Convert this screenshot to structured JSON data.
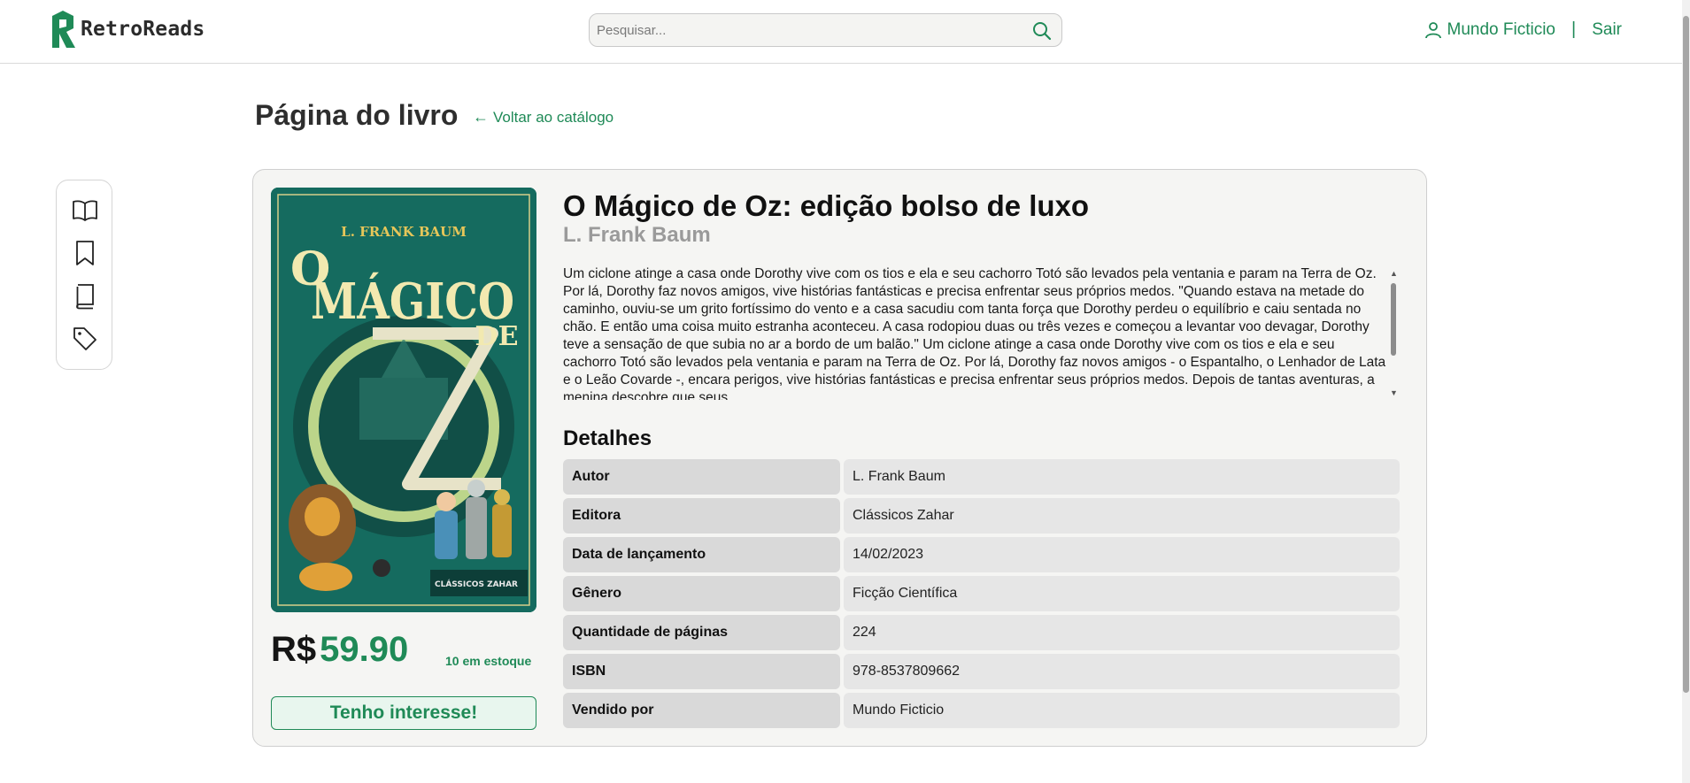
{
  "app": {
    "name": "RetroReads",
    "brand_color": "#1f8a57"
  },
  "header": {
    "search_placeholder": "Pesquisar...",
    "user_name": "Mundo Ficticio",
    "separator": "|",
    "logout_label": "Sair"
  },
  "page": {
    "title": "Página do livro",
    "back_label": "Voltar ao catálogo"
  },
  "sidebar": {
    "items": [
      {
        "icon": "open-book-icon"
      },
      {
        "icon": "bookmark-icon"
      },
      {
        "icon": "book-icon"
      },
      {
        "icon": "tag-icon"
      }
    ]
  },
  "book": {
    "title": "O Mágico de Oz: edição bolso de luxo",
    "author": "L. Frank Baum",
    "cover": {
      "author_text": "L. FRANK BAUM",
      "line1": "O",
      "line2": "MÁGICO",
      "line3": "DE",
      "line4": "OZ",
      "publisher_text": "CLÁSSICOS ZAHAR"
    },
    "description": "Um ciclone atinge a casa onde Dorothy vive com os tios e ela e seu cachorro Totó são levados pela ventania e param na Terra de Oz. Por lá, Dorothy faz novos amigos, vive histórias fantásticas e precisa enfrentar seus próprios medos. \"Quando estava na metade do caminho, ouviu-se um grito fortíssimo do vento e a casa sacudiu com tanta força que Dorothy perdeu o equilíbrio e caiu sentada no chão. E então uma coisa muito estranha aconteceu. A casa rodopiou duas ou três vezes e começou a levantar voo devagar, Dorothy teve a sensação de que subia no ar a bordo de um balão.\" Um ciclone atinge a casa onde Dorothy vive com os tios e ela e seu cachorro Totó são levados pela ventania e param na Terra de Oz. Por lá, Dorothy faz novos amigos - o Espantalho, o Lenhador de Lata e o Leão Covarde -, encara perigos, vive histórias fantásticas e precisa enfrentar seus próprios medos. Depois de tantas aventuras, a menina descobre que seus",
    "price_currency": "R$",
    "price_value": "59.90",
    "stock": "10 em estoque",
    "interest_label": "Tenho interesse!"
  },
  "details": {
    "title": "Detalhes",
    "rows": [
      {
        "label": "Autor",
        "value": "L. Frank Baum"
      },
      {
        "label": "Editora",
        "value": "Clássicos Zahar"
      },
      {
        "label": "Data de lançamento",
        "value": "14/02/2023"
      },
      {
        "label": "Gênero",
        "value": "Ficção Científica"
      },
      {
        "label": "Quantidade de páginas",
        "value": "224"
      },
      {
        "label": "ISBN",
        "value": "978-8537809662"
      },
      {
        "label": "Vendido por",
        "value": "Mundo Ficticio"
      }
    ]
  }
}
